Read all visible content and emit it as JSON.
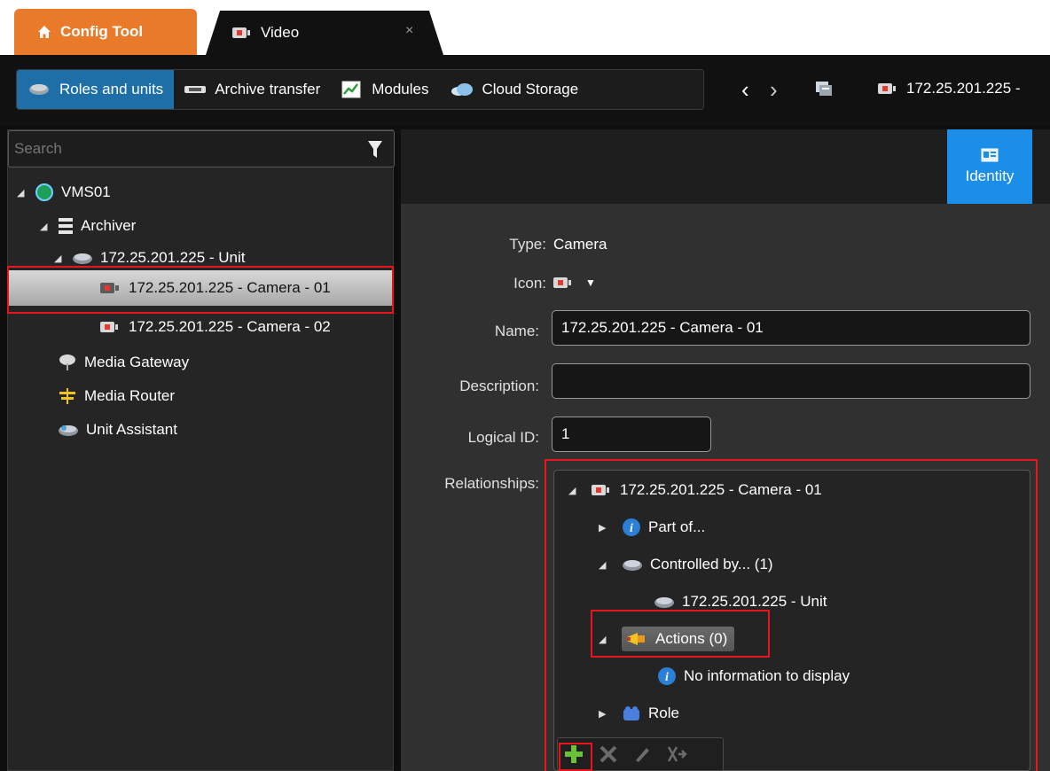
{
  "tabs": {
    "config_tool": "Config Tool",
    "video": "Video",
    "close": "×"
  },
  "toolbar": {
    "segments": [
      "Roles and units",
      "Archive transfer",
      "Modules",
      "Cloud Storage"
    ],
    "back": "‹",
    "forward": "›",
    "breadcrumb": "172.25.201.225 -"
  },
  "left": {
    "search_placeholder": "Search",
    "tree": {
      "root": "VMS01",
      "archiver": "Archiver",
      "unit": "172.25.201.225 - Unit",
      "camera1": "172.25.201.225 - Camera - 01",
      "camera2": "172.25.201.225 - Camera - 02",
      "media_gateway": "Media Gateway",
      "media_router": "Media Router",
      "unit_assistant": "Unit Assistant"
    }
  },
  "right": {
    "identity_tab": "Identity",
    "type_label": "Type:",
    "type_value": "Camera",
    "icon_label": "Icon:",
    "name_label": "Name:",
    "name_value": "172.25.201.225 - Camera - 01",
    "description_label": "Description:",
    "description_value": "",
    "logical_id_label": "Logical ID:",
    "logical_id_value": "1",
    "relationships_label": "Relationships:",
    "relationships": {
      "root": "172.25.201.225 - Camera - 01",
      "part_of": "Part of...",
      "controlled_by": "Controlled by... (1)",
      "controlled_unit": "172.25.201.225 - Unit",
      "actions": "Actions (0)",
      "no_info": "No information to display",
      "role": "Role"
    }
  },
  "colors": {
    "accent": "#1a8ee8",
    "config_tab": "#e97a2a",
    "highlight": "#e8161c"
  }
}
